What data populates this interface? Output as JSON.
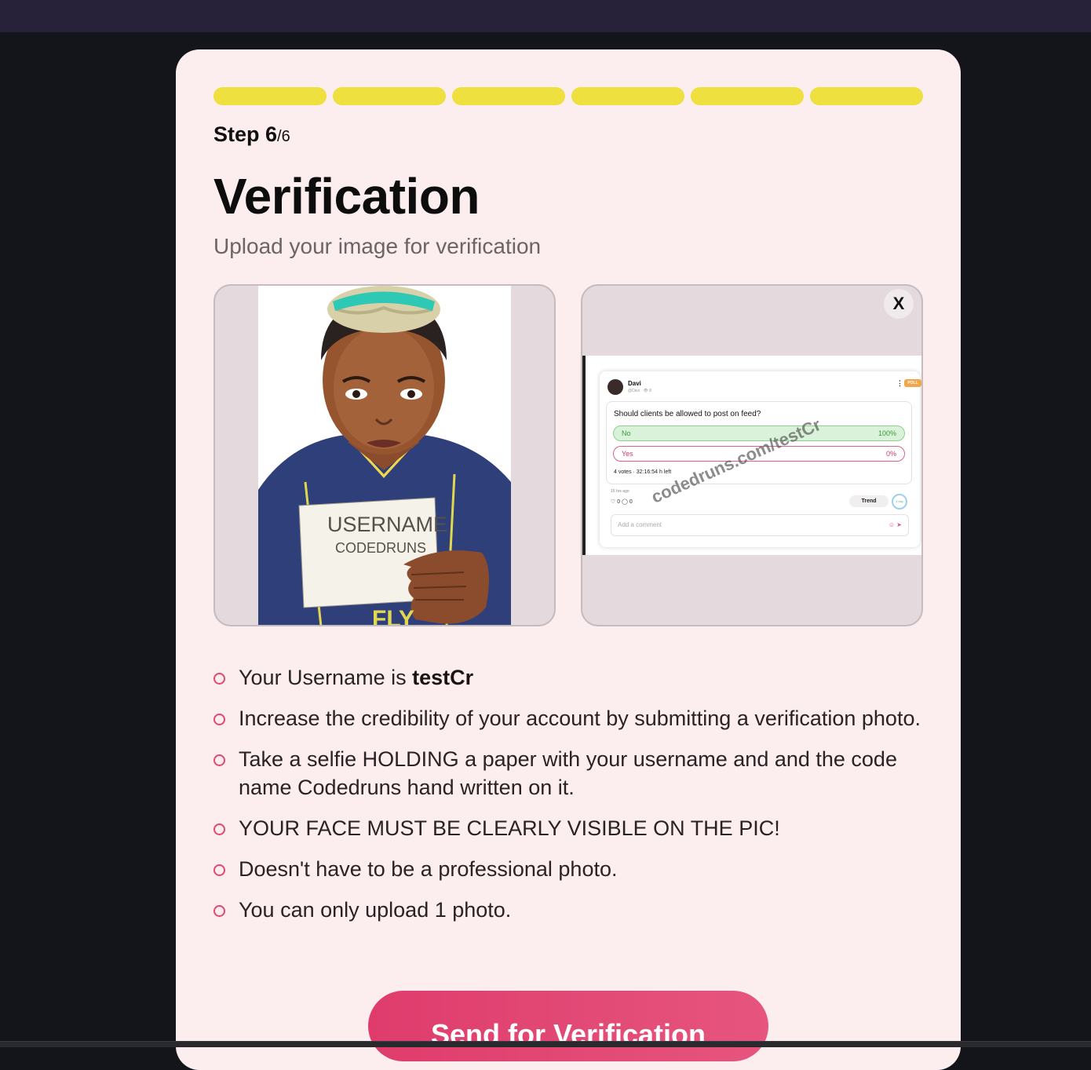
{
  "progress": {
    "total_steps": 6,
    "completed_steps": 6,
    "color": "#eee03e"
  },
  "step": {
    "prefix": "Step 6",
    "total": "/6"
  },
  "title": "Verification",
  "subtitle": "Upload your image for verification",
  "sample_image": {
    "sign_line1": "USERNAME",
    "sign_line2": "CODEDRUNS"
  },
  "upload_preview": {
    "close_label": "X",
    "post": {
      "name": "Davi",
      "handle": "@Davi · 👁 8",
      "badge": "POLL",
      "menu": "⋮",
      "question": "Should clients be allowed to post on feed?",
      "options": [
        {
          "label": "No",
          "pct": "100%"
        },
        {
          "label": "Yes",
          "pct": "0%"
        }
      ],
      "votes": "4 votes · 32:16:54 h left",
      "time": "15 hrs ago",
      "reactions": "♡ 0  ◯ 0",
      "trend": "Trend",
      "timer": "3 day",
      "comment_placeholder": "Add a comment"
    },
    "watermark": "codedruns.com/testCr"
  },
  "rules": {
    "username_prefix": "Your Username is ",
    "username": "testCr",
    "items": [
      "Increase the credibility of your account by submitting a verification photo.",
      "Take a selfie HOLDING a paper with your username and and the code name Codedruns hand written on it.",
      "YOUR FACE MUST BE CLEARLY VISIBLE ON THE PIC!",
      "Doesn't have to be a professional photo.",
      "You can only upload 1 photo."
    ]
  },
  "submit_label": "Send for Verification",
  "colors": {
    "card": "#fcedef",
    "accent": "#e0486f",
    "background": "#14151b",
    "topbar": "#27213a"
  }
}
